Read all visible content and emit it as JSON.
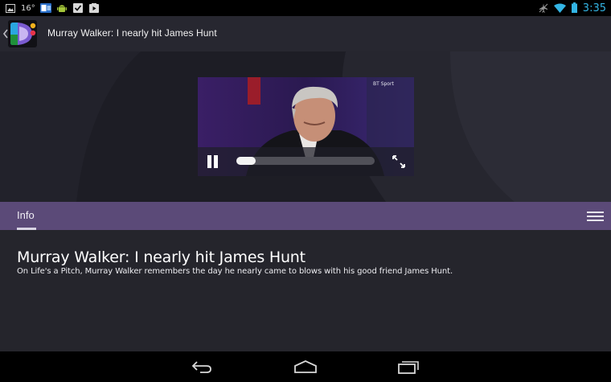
{
  "status_bar": {
    "temperature": "16°",
    "time": "3:35",
    "icons": [
      "image-notification-icon",
      "outlook-icon",
      "android-icon",
      "task-done-icon",
      "play-store-icon",
      "airplane-mode-icon",
      "wifi-icon",
      "battery-icon"
    ]
  },
  "action_bar": {
    "title": "Murray Walker: I nearly hit James Hunt"
  },
  "video": {
    "watermark": "BT Sport",
    "progress": 0.14,
    "state": "playing"
  },
  "tabs": {
    "active": "Info"
  },
  "article": {
    "title": "Murray Walker: I nearly hit James Hunt",
    "description": "On Life's a Pitch, Murray Walker remembers the day he nearly came to blows with his good friend James Hunt."
  },
  "colors": {
    "accent_blue": "#33b5e5",
    "tab_purple": "#5b4a78",
    "content_bg": "#25252c"
  }
}
